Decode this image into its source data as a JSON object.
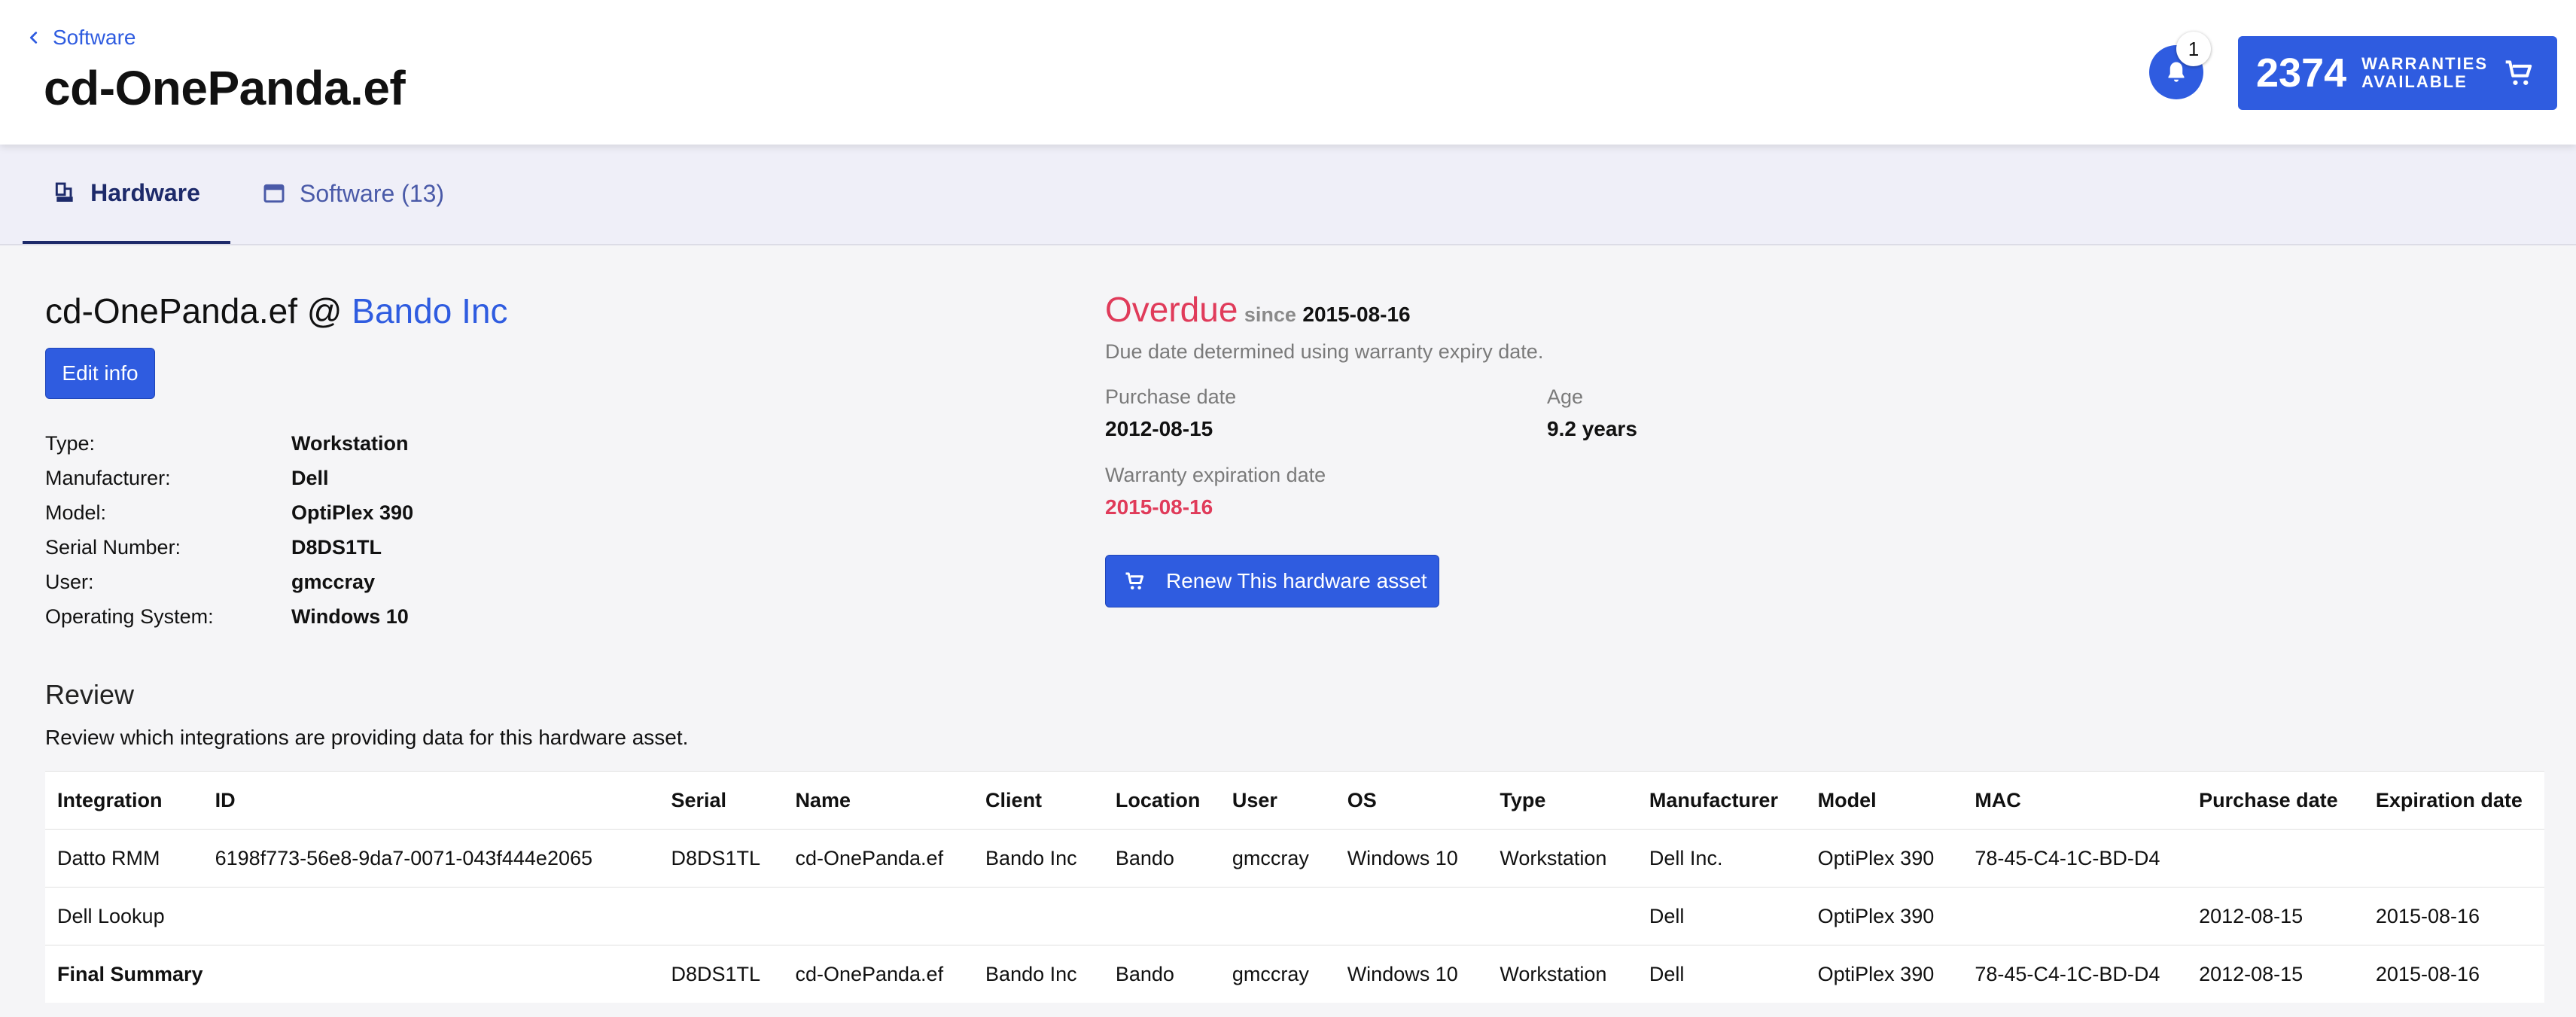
{
  "breadcrumb": {
    "label": "Software"
  },
  "page": {
    "title": "cd-OnePanda.ef"
  },
  "notifications": {
    "count": "1"
  },
  "warranties": {
    "count": "2374",
    "label_line1": "WARRANTIES",
    "label_line2": "AVAILABLE"
  },
  "tabs": [
    {
      "label": "Hardware",
      "active": true
    },
    {
      "label": "Software (13)",
      "active": false
    }
  ],
  "asset": {
    "name": "cd-OnePanda.ef",
    "at": "@",
    "client": "Bando Inc",
    "edit_label": "Edit info",
    "properties": [
      {
        "label": "Type:",
        "value": "Workstation"
      },
      {
        "label": "Manufacturer:",
        "value": "Dell"
      },
      {
        "label": "Model:",
        "value": "OptiPlex 390"
      },
      {
        "label": "Serial Number:",
        "value": "D8DS1TL"
      },
      {
        "label": "User:",
        "value": "gmccray"
      },
      {
        "label": "Operating System:",
        "value": "Windows 10"
      }
    ]
  },
  "status": {
    "state": "Overdue",
    "since_label": "since",
    "since_date": "2015-08-16",
    "note": "Due date determined using warranty expiry date.",
    "purchase_label": "Purchase date",
    "purchase_value": "2012-08-15",
    "age_label": "Age",
    "age_value": "9.2 years",
    "warranty_label": "Warranty expiration date",
    "warranty_value": "2015-08-16",
    "renew_label": "Renew This hardware asset"
  },
  "review": {
    "title": "Review",
    "description": "Review which integrations are providing data for this hardware asset.",
    "columns": [
      "Integration",
      "ID",
      "Serial",
      "Name",
      "Client",
      "Location",
      "User",
      "OS",
      "Type",
      "Manufacturer",
      "Model",
      "MAC",
      "Purchase date",
      "Expiration date"
    ],
    "rows": [
      [
        "Datto RMM",
        "6198f773-56e8-9da7-0071-043f444e2065",
        "D8DS1TL",
        "cd-OnePanda.ef",
        "Bando Inc",
        "Bando",
        "gmccray",
        "Windows 10",
        "Workstation",
        "Dell Inc.",
        "OptiPlex 390",
        "78-45-C4-1C-BD-D4",
        "",
        ""
      ],
      [
        "Dell Lookup",
        "",
        "",
        "",
        "",
        "",
        "",
        "",
        "",
        "Dell",
        "OptiPlex 390",
        "",
        "2012-08-15",
        "2015-08-16"
      ],
      [
        "Final Summary",
        "",
        "D8DS1TL",
        "cd-OnePanda.ef",
        "Bando Inc",
        "Bando",
        "gmccray",
        "Windows 10",
        "Workstation",
        "Dell",
        "OptiPlex 390",
        "78-45-C4-1C-BD-D4",
        "2012-08-15",
        "2015-08-16"
      ]
    ]
  },
  "colors": {
    "accent": "#2f5ce0",
    "overdue": "#e03b5a",
    "tab_active": "#1d2a6a"
  },
  "icons": [
    "chevron-left-icon",
    "bell-icon",
    "cart-icon",
    "hardware-icon",
    "window-icon"
  ]
}
